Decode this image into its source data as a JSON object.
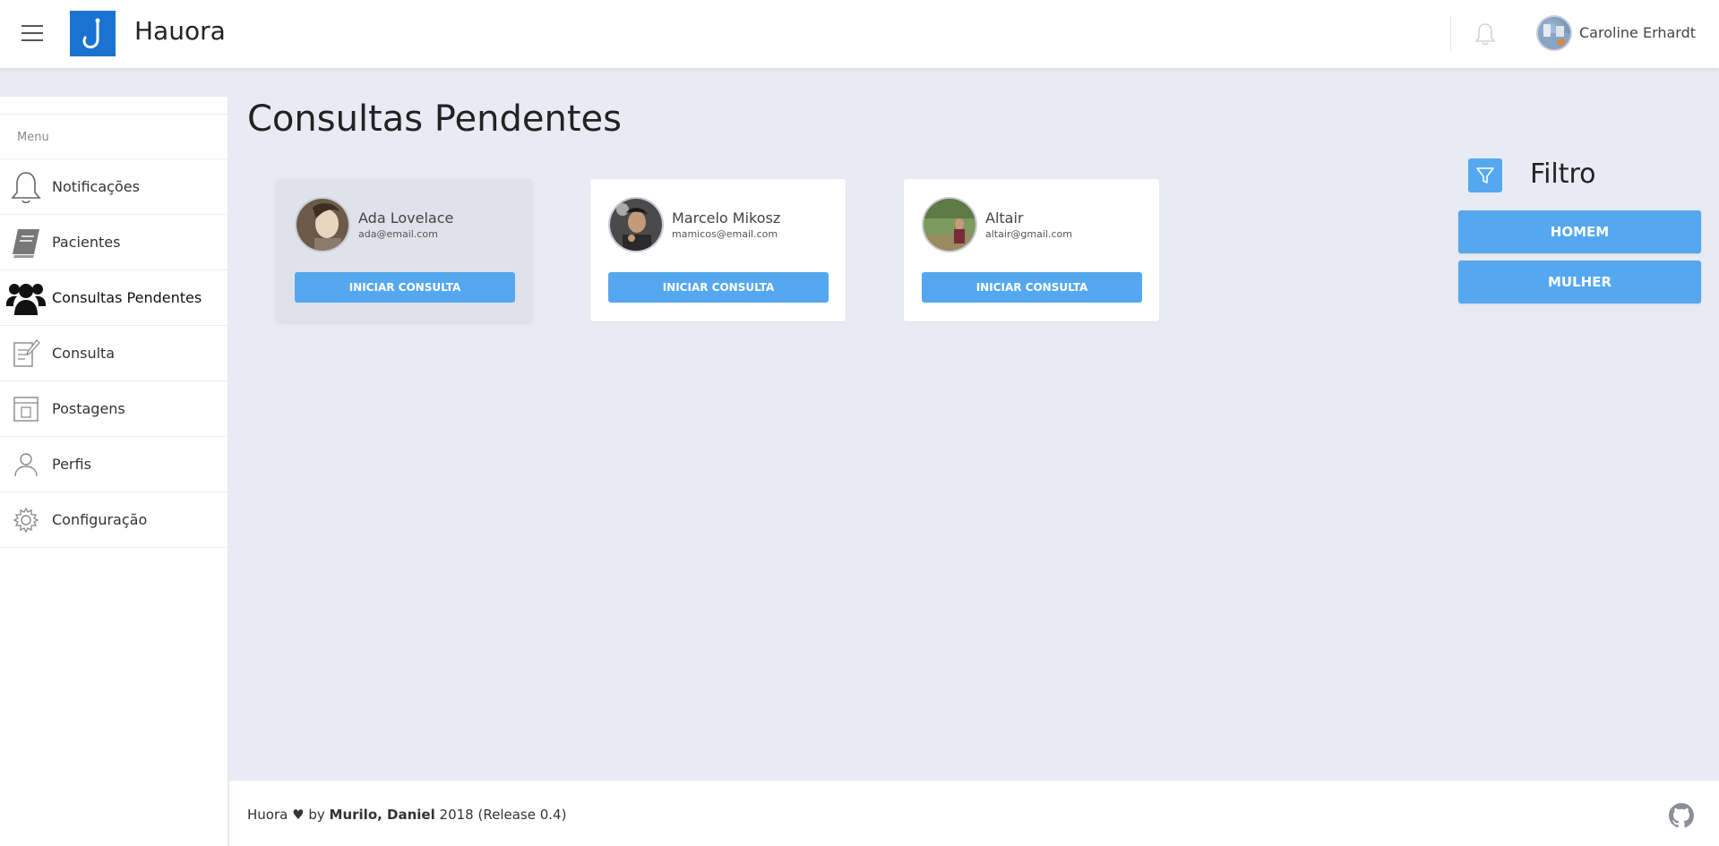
{
  "header": {
    "brand": "Hauora",
    "user_name": "Caroline Erhardt"
  },
  "sidebar": {
    "menu_label": "Menu",
    "items": [
      {
        "label": "Notificações",
        "icon": "bell-icon"
      },
      {
        "label": "Pacientes",
        "icon": "book-icon"
      },
      {
        "label": "Consultas Pendentes",
        "icon": "users-icon"
      },
      {
        "label": "Consulta",
        "icon": "edit-icon"
      },
      {
        "label": "Postagens",
        "icon": "layout-icon"
      },
      {
        "label": "Perfis",
        "icon": "user-icon"
      },
      {
        "label": "Configuração",
        "icon": "gear-icon"
      }
    ],
    "active_index": 2
  },
  "main": {
    "title": "Consultas Pendentes",
    "cards": [
      {
        "name": "Ada Lovelace",
        "email": "ada@email.com",
        "button": "INICIAR CONSULTA"
      },
      {
        "name": "Marcelo Mikosz",
        "email": "mamicos@email.com",
        "button": "INICIAR CONSULTA"
      },
      {
        "name": "Altair",
        "email": "altair@gmail.com",
        "button": "INICIAR CONSULTA"
      }
    ]
  },
  "filter": {
    "title": "Filtro",
    "options": [
      "HOMEM",
      "MULHER"
    ]
  },
  "footer": {
    "brand": "Huora",
    "heart": "♥",
    "by": "by",
    "authors": "Murilo, Daniel",
    "year_release": "2018 (Release 0.4)"
  },
  "colors": {
    "accent": "#55a8f0",
    "logo": "#1a73d0",
    "background": "#e8ebf3"
  }
}
